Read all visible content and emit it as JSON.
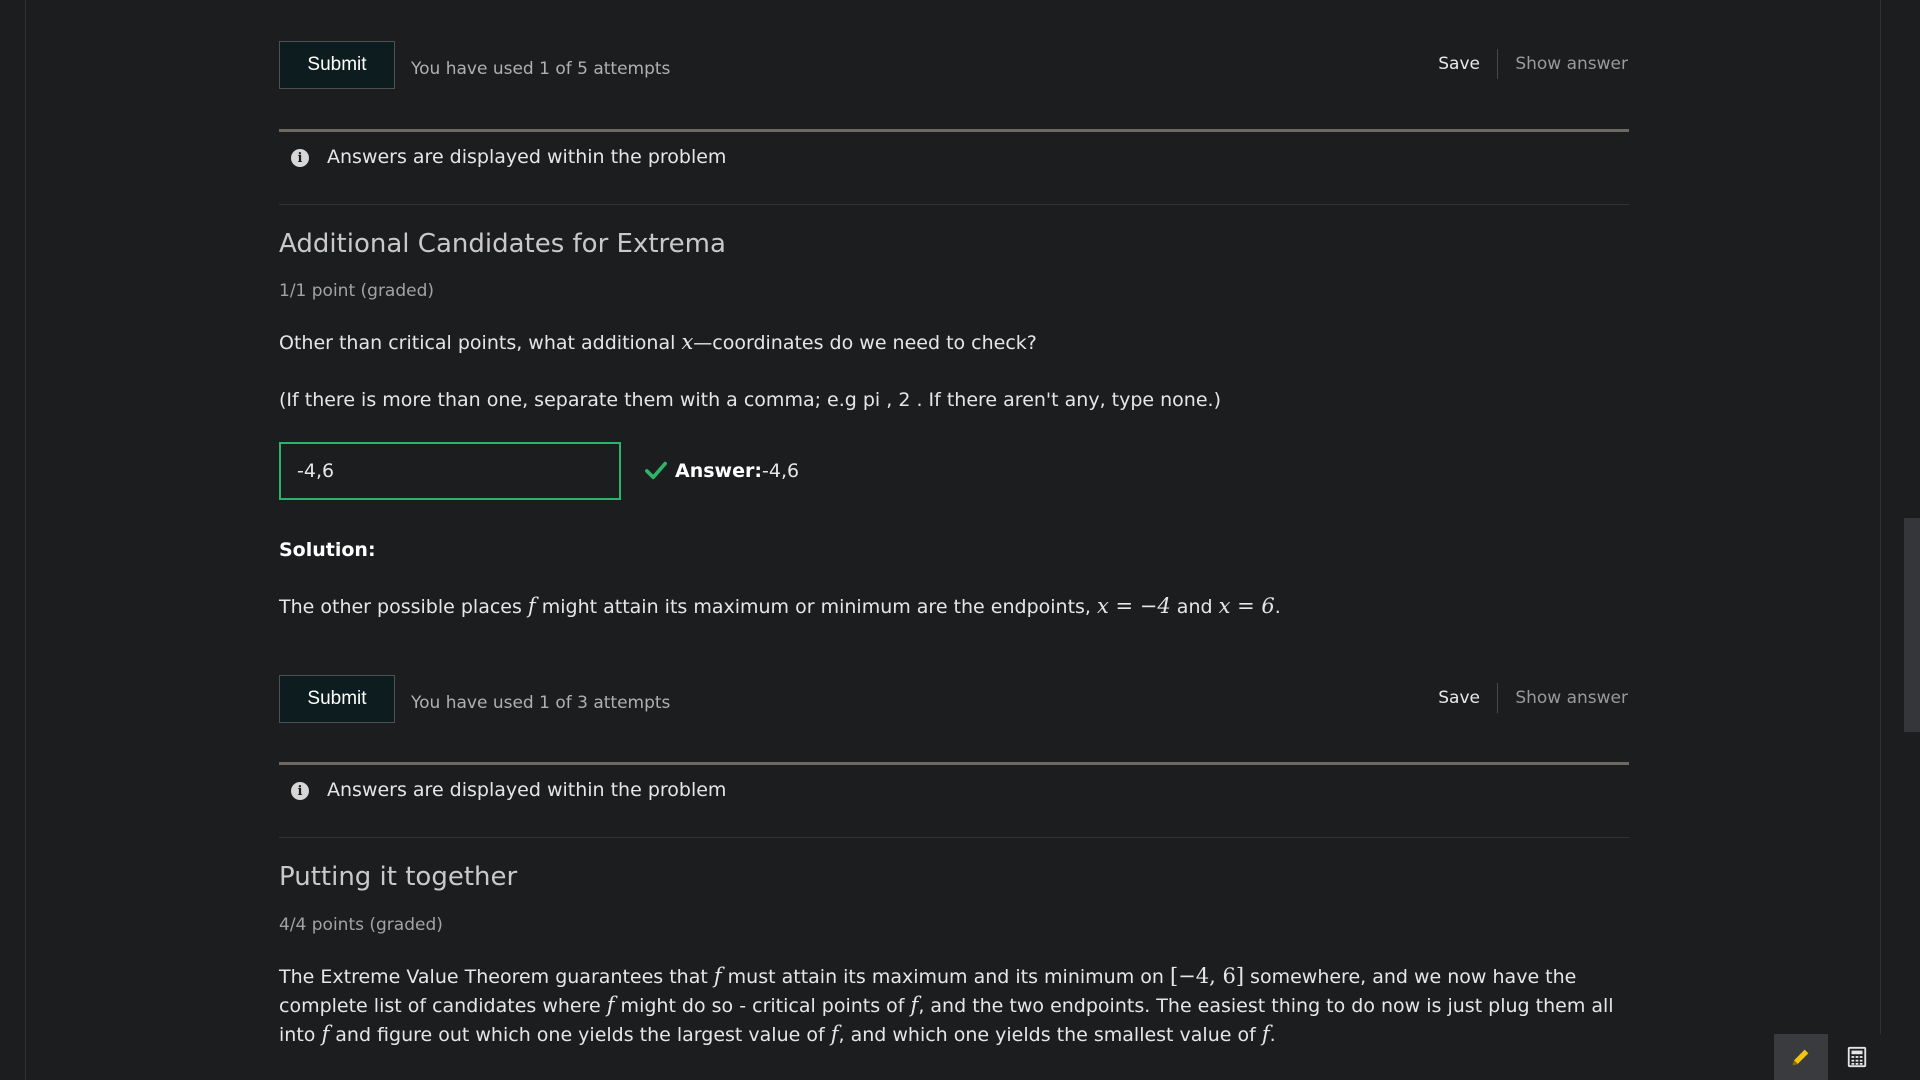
{
  "problem_a": {
    "submit_label": "Submit",
    "attempts_text": "You have used 1 of 5 attempts",
    "save_label": "Save",
    "show_answer_label": "Show answer",
    "notice_text": "Answers are displayed within the problem"
  },
  "problem_b": {
    "title": "Additional Candidates for Extrema",
    "points": "1/1 point (graded)",
    "question_prefix": "Other than critical points, what additional ",
    "question_var": "x",
    "question_suffix": "—coordinates do we need to check?",
    "instructions": "(If there is more than one, separate them with a comma; e.g pi , 2 . If there aren't any, type none.)",
    "input_value": "-4,6",
    "answer_label": "Answer:",
    "answer_value": "-4,6",
    "solution_label": "Solution:",
    "solution_prefix": "The other possible places ",
    "solution_f": "f",
    "solution_mid": " might attain its maximum or minimum are the endpoints, ",
    "solution_eq1": "x = −4",
    "solution_and": " and ",
    "solution_eq2": "x = 6",
    "solution_end": ".",
    "submit_label": "Submit",
    "attempts_text": "You have used 1 of 3 attempts",
    "save_label": "Save",
    "show_answer_label": "Show answer",
    "notice_text": "Answers are displayed within the problem"
  },
  "problem_c": {
    "title": "Putting it together",
    "points": "4/4 points (graded)",
    "p1": "The Extreme Value Theorem guarantees that ",
    "f": "f",
    "p2": " must attain its maximum and its minimum on ",
    "interval": "[−4, 6]",
    "p3": " somewhere, and we now have the",
    "p4": "complete list of candidates where ",
    "p5": " might do so - critical points of ",
    "p6": ", and the two endpoints. The easiest thing to do now is just plug them all",
    "p7": "into ",
    "p8": " and figure out which one yields the largest value of ",
    "p9": ", and which one yields the smallest value of ",
    "p10": "."
  },
  "tools": {
    "pencil_icon": "pencil-icon",
    "calculator_icon": "calculator-icon",
    "pencil_color": "#f1c40f"
  },
  "colors": {
    "background": "#1c1d1f",
    "correct_green": "#2fb36a",
    "submit_bg": "#0d1c1e"
  }
}
